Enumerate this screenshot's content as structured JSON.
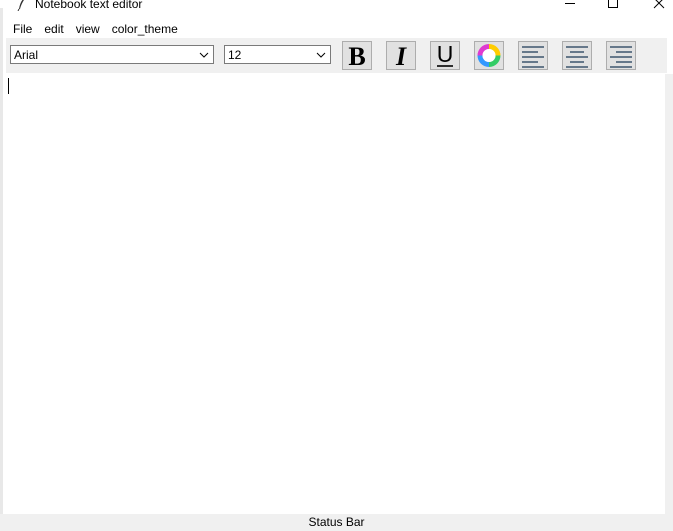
{
  "window": {
    "title": "Notebook text editor",
    "icon": "feather-icon",
    "controls": [
      "minimize-icon",
      "maximize-icon",
      "close-icon"
    ]
  },
  "menu": {
    "items": [
      "File",
      "edit",
      "view",
      "color_theme"
    ]
  },
  "toolbar": {
    "font_family": "Arial",
    "font_size": "12",
    "bold_glyph": "B",
    "italic_glyph": "I",
    "underline_glyph": "U",
    "buttons": [
      "bold-icon",
      "italic-icon",
      "underline-icon",
      "color-wheel-icon",
      "align-left-icon",
      "align-center-icon",
      "align-right-icon"
    ]
  },
  "editor": {
    "content": ""
  },
  "status_bar": {
    "text": "Status Bar"
  }
}
